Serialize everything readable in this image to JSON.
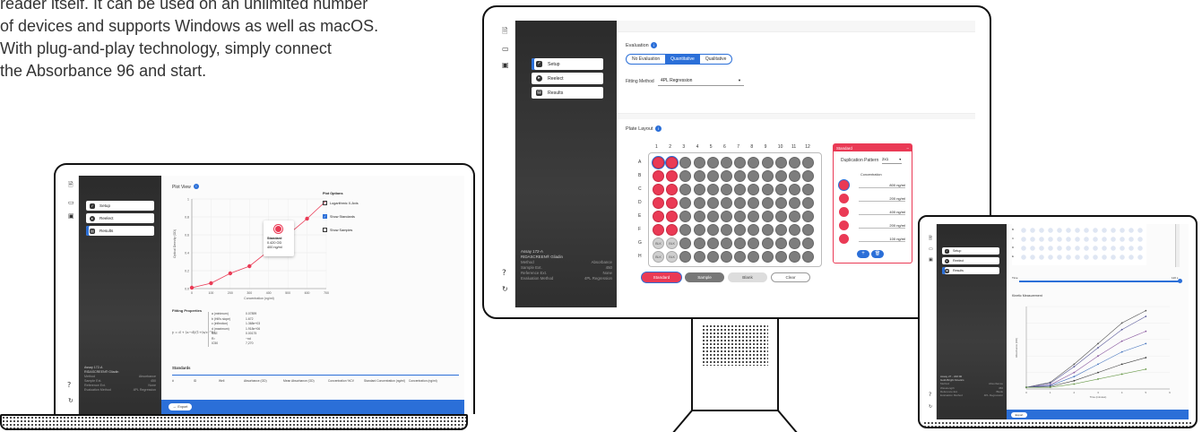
{
  "intro_lines": [
    "reader itself. It can be used on an unlimited number",
    "of devices and supports Windows as well as macOS.",
    "With plug-and-play technology, simply connect",
    "the Absorbance 96 and start."
  ],
  "nav": {
    "setup": "Setup",
    "reelect": "Reelect",
    "results": "Results"
  },
  "assay": {
    "title": "Assay 172-A",
    "subtitle": "RIDASCREEN® Gliadin",
    "rows": [
      {
        "k": "Method",
        "v": "Absorbance"
      },
      {
        "k": "Sample Ext.",
        "v": "450"
      },
      {
        "k": "Reference Ext.",
        "v": "None"
      },
      {
        "k": "Evaluation Method",
        "v": "4PL Regression"
      }
    ]
  },
  "laptop": {
    "plot_title": "Plot View",
    "plot_options": {
      "title": "Plot Options",
      "items": [
        {
          "label": "Logarithmic X-Axis",
          "checked": false
        },
        {
          "label": "Show Standards",
          "checked": true
        },
        {
          "label": "Show Samples",
          "checked": false
        }
      ]
    },
    "tooltip": {
      "title": "Standard",
      "od": "0.420 OD",
      "conc": "400 ng/ml"
    },
    "x_axis_label": "Concentration (ng/ml)",
    "y_axis_label": "Optical Density (OD)",
    "fitting_title": "Fitting Properties",
    "formula": "y = d + (a−d)/(1+(x/c)^b)",
    "fitting": [
      {
        "k": "a (minimum)",
        "v": "0.07899"
      },
      {
        "k": "b (Hill's slope)",
        "v": "1.672"
      },
      {
        "k": "c (inflection)",
        "v": "1.368e+03"
      },
      {
        "k": "d (maximum)",
        "v": "1.918e+06"
      },
      {
        "k": "SSE",
        "v": "0.00175"
      },
      {
        "k": "R²",
        "v": "~nd"
      },
      {
        "k": "IC50",
        "v": "7,270"
      }
    ],
    "standards_title": "Standards",
    "standards_cols": [
      "#",
      "ID",
      "Well",
      "Absorbance (OD)",
      "Mean Absorbance (OD)",
      "Concentration %CV",
      "Standard Concentration (ng/ml)",
      "Concentration (ng/ml)"
    ],
    "export": "Export"
  },
  "laptop_chart": {
    "type": "scatter",
    "x": [
      0,
      100,
      200,
      300,
      400,
      500,
      600,
      700
    ],
    "x_ticks": [
      "0",
      "100",
      "200",
      "300",
      "400",
      "500",
      "600",
      "700"
    ],
    "y_ticks": [
      "0.0",
      "0.2",
      "0.4",
      "0.6",
      "0.8",
      "1"
    ],
    "points": [
      [
        0,
        0.01
      ],
      [
        100,
        0.06
      ],
      [
        200,
        0.17
      ],
      [
        300,
        0.25
      ],
      [
        400,
        0.42
      ],
      [
        500,
        0.6
      ],
      [
        600,
        0.78
      ]
    ],
    "xlim": [
      0,
      700
    ],
    "ylim": [
      0,
      1.0
    ]
  },
  "monitor": {
    "evaluation_title": "Evaluation",
    "eval_options": [
      "No Evaluation",
      "Quantitative",
      "Qualitative"
    ],
    "eval_selected": "Quantitative",
    "fitting_method_label": "Fitting Method",
    "fitting_method_value": "4PL Regression",
    "plate_title": "Plate Layout",
    "cols": [
      "1",
      "2",
      "3",
      "4",
      "5",
      "6",
      "7",
      "8",
      "9",
      "10",
      "11",
      "12"
    ],
    "rows": [
      "A",
      "B",
      "C",
      "D",
      "E",
      "F",
      "G",
      "H"
    ],
    "blank_label": "BLK",
    "panel": {
      "title": "Standard",
      "dup_label": "Duplication Pattern",
      "dup_value": "2x1",
      "conc_title": "Concentration",
      "concs": [
        "800 ng/ml",
        "200 ng/ml",
        "400 ng/ml",
        "200 ng/ml",
        "100 ng/ml"
      ]
    },
    "buttons": [
      "Standard",
      "Sample",
      "Blank",
      "Clear"
    ]
  },
  "tablet": {
    "kinetic_title": "Kinetic Measurement",
    "rows": [
      "B",
      "C",
      "D",
      "E"
    ],
    "time_label": "Time",
    "time_value": "120 s",
    "assay_title": "Assay 27 - 220:00",
    "assay_sub": "Gold-Bright Kinetics",
    "rows_kv": [
      {
        "k": "Method",
        "v": "Absorbance"
      },
      {
        "k": "Wavelength",
        "v": "450"
      },
      {
        "k": "Reference Ext.",
        "v": "Blank"
      },
      {
        "k": "Evaluation Method",
        "v": "4PL Regression"
      }
    ],
    "x_ticks": [
      "0",
      "1",
      "2",
      "3",
      "4",
      "5",
      "6"
    ],
    "x_label": "Time (minutes)",
    "y_label": "Absorbance (OD)",
    "export": "Export"
  },
  "tablet_chart": {
    "type": "line",
    "x": [
      0,
      1,
      2,
      3,
      4,
      5
    ],
    "series": [
      {
        "values": [
          0.02,
          0.08,
          0.3,
          0.55,
          0.8,
          0.95
        ]
      },
      {
        "values": [
          0.02,
          0.07,
          0.27,
          0.5,
          0.72,
          0.88
        ]
      },
      {
        "values": [
          0.02,
          0.05,
          0.2,
          0.4,
          0.58,
          0.7
        ]
      },
      {
        "values": [
          0.02,
          0.04,
          0.15,
          0.3,
          0.45,
          0.55
        ]
      },
      {
        "values": [
          0.02,
          0.03,
          0.1,
          0.2,
          0.3,
          0.38
        ]
      },
      {
        "values": [
          0.02,
          0.02,
          0.06,
          0.12,
          0.18,
          0.24
        ]
      }
    ],
    "colors": [
      "#555555",
      "#5a5a9a",
      "#8a5aa0",
      "#4a78c0",
      "#3a3a3a",
      "#6a9a4a"
    ],
    "ylim": [
      0,
      1.0
    ]
  },
  "colors": {
    "accent": "#2b6fd8",
    "standard_red": "#ea3a55",
    "dark_sidebar": "#2f2f2f"
  }
}
